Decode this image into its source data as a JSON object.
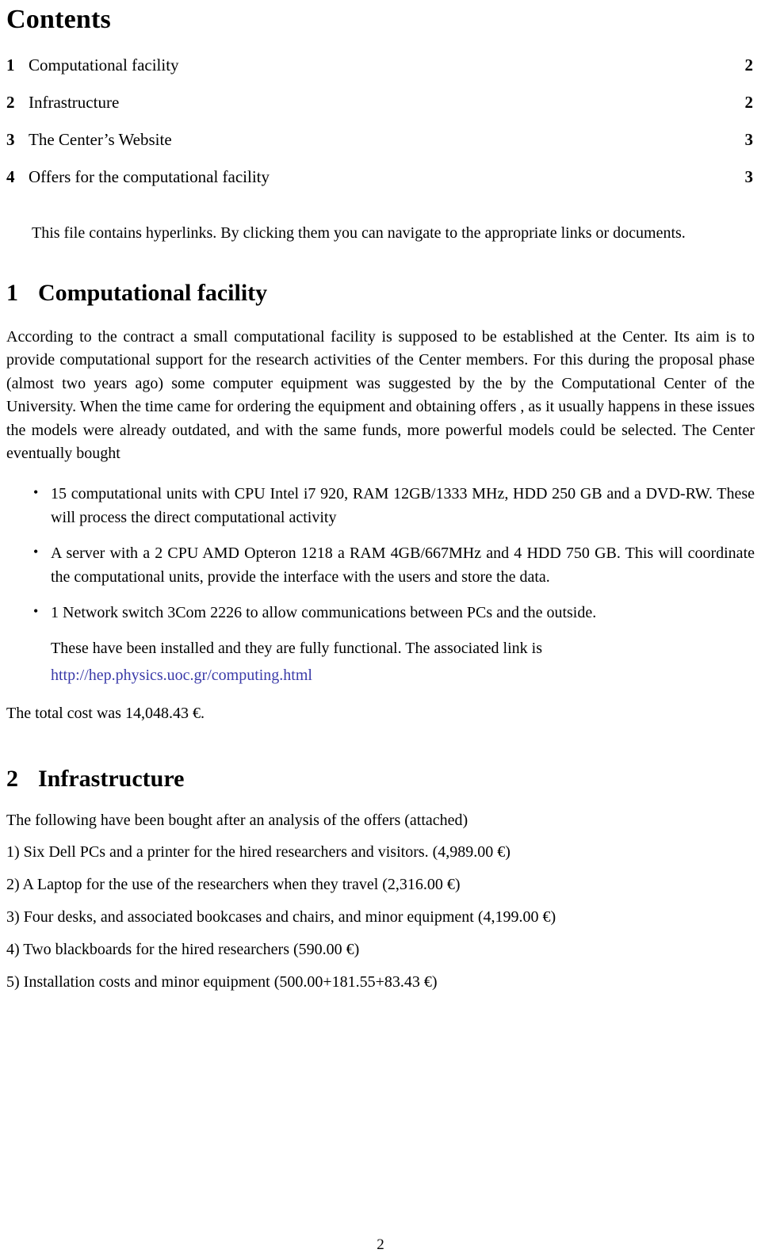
{
  "document": {
    "contents_title": "Contents",
    "toc": [
      {
        "num": "1",
        "label": "Computational facility",
        "page": "2"
      },
      {
        "num": "2",
        "label": "Infrastructure",
        "page": "2"
      },
      {
        "num": "3",
        "label": "The Center’s Website",
        "page": "3"
      },
      {
        "num": "4",
        "label": "Offers for the computational facility",
        "page": "3"
      }
    ],
    "note": "This file contains hyperlinks. By clicking them you can navigate to the appropriate links or documents.",
    "section1": {
      "num": "1",
      "title": "Computational facility",
      "paragraph": "According to the contract a small computational facility is supposed to be established at the Center. Its aim is to provide computational support for the research activities of the Center members. For this during the proposal phase (almost two years ago) some computer equipment was suggested by the by the Computational Center of the University. When the time came for ordering the equipment and obtaining offers , as it usually happens in these issues the models were already outdated, and with the same funds, more powerful models could be selected. The Center eventually bought",
      "bullets": [
        "15 computational units with CPU Intel i7 920, RAM 12GB/1333 MHz, HDD 250 GB and a DVD-RW. These will process the direct computational activity",
        "A server with a 2 CPU AMD Opteron 1218 a RAM 4GB/667MHz and 4 HDD 750 GB. This will coordinate the computational units, provide the interface with the users and store the data.",
        "1 Network switch 3Com 2226 to allow communications between PCs and the outside."
      ],
      "after_bullets": "These have been installed and they are fully functional. The associated link is",
      "link_text": "http://hep.physics.uoc.gr/computing.html",
      "total_cost": "The total cost was 14,048.43 €."
    },
    "section2": {
      "num": "2",
      "title": "Infrastructure",
      "intro": "The following have been bought after an analysis of the offers (attached)",
      "items": [
        "1) Six Dell PCs and a printer for the hired researchers and visitors. (4,989.00 €)",
        "2) A Laptop for the use of the researchers when they travel (2,316.00 €)",
        "3) Four desks, and associated bookcases and chairs, and minor equipment (4,199.00 €)",
        "4) Two blackboards for the hired researchers (590.00 €)",
        "5) Installation costs and minor equipment (500.00+181.55+83.43 €)"
      ]
    },
    "page_number": "2",
    "link_color": "#3a3aa8"
  }
}
